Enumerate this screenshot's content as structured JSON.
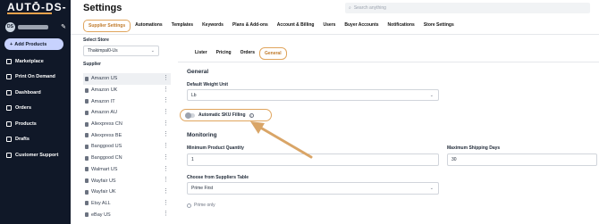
{
  "sidebar": {
    "logo": "AUTŌ-DS-",
    "user_initials": "DS",
    "add_products": "Add Products",
    "items": [
      {
        "label": "Marketplace",
        "icon": "store-icon"
      },
      {
        "label": "Print On Demand",
        "icon": "print-icon"
      },
      {
        "label": "Dashboard",
        "icon": "dashboard-icon"
      },
      {
        "label": "Orders",
        "icon": "orders-icon"
      },
      {
        "label": "Products",
        "icon": "products-icon"
      },
      {
        "label": "Drafts",
        "icon": "drafts-icon"
      },
      {
        "label": "Customer Support",
        "icon": "support-icon"
      }
    ]
  },
  "header": {
    "title": "Settings",
    "search_placeholder": "Search anything"
  },
  "tabs": [
    {
      "label": "Supplier Settings",
      "active": true
    },
    {
      "label": "Automations"
    },
    {
      "label": "Templates"
    },
    {
      "label": "Keywords"
    },
    {
      "label": "Plans & Add-ons"
    },
    {
      "label": "Account & Billing"
    },
    {
      "label": "Users"
    },
    {
      "label": "Buyer Accounts"
    },
    {
      "label": "Notifications"
    },
    {
      "label": "Store Settings"
    }
  ],
  "store": {
    "label": "Select Store",
    "value": "Thakimpal0-Us"
  },
  "supplier": {
    "label": "Supplier",
    "items": [
      "Amazon US",
      "Amazon UK",
      "Amazon IT",
      "Amazon AU",
      "Aliexpress CN",
      "Aliexpress BE",
      "Banggood US",
      "Banggood CN",
      "Walmart US",
      "Wayfair US",
      "Wayfair UK",
      "Etsy ALL",
      "eBay US"
    ]
  },
  "subtabs": [
    {
      "label": "Lister"
    },
    {
      "label": "Pricing"
    },
    {
      "label": "Orders"
    },
    {
      "label": "General",
      "active": true
    }
  ],
  "general": {
    "title": "General",
    "weight_label": "Default Weight Unit",
    "weight_value": "Lb",
    "auto_sku_label": "Automatic SKU Filling"
  },
  "monitoring": {
    "title": "Monitoring",
    "min_qty_label": "Minimum Product Quantity",
    "min_qty_value": "1",
    "max_days_label": "Maximum Shipping Days",
    "max_days_value": "30",
    "choose_label": "Choose from Suppliers Table",
    "choose_value": "Prime First",
    "prime_only": "Prime only"
  },
  "colors": {
    "sidebar_bg": "#101828",
    "accent": "#e0a55d"
  }
}
